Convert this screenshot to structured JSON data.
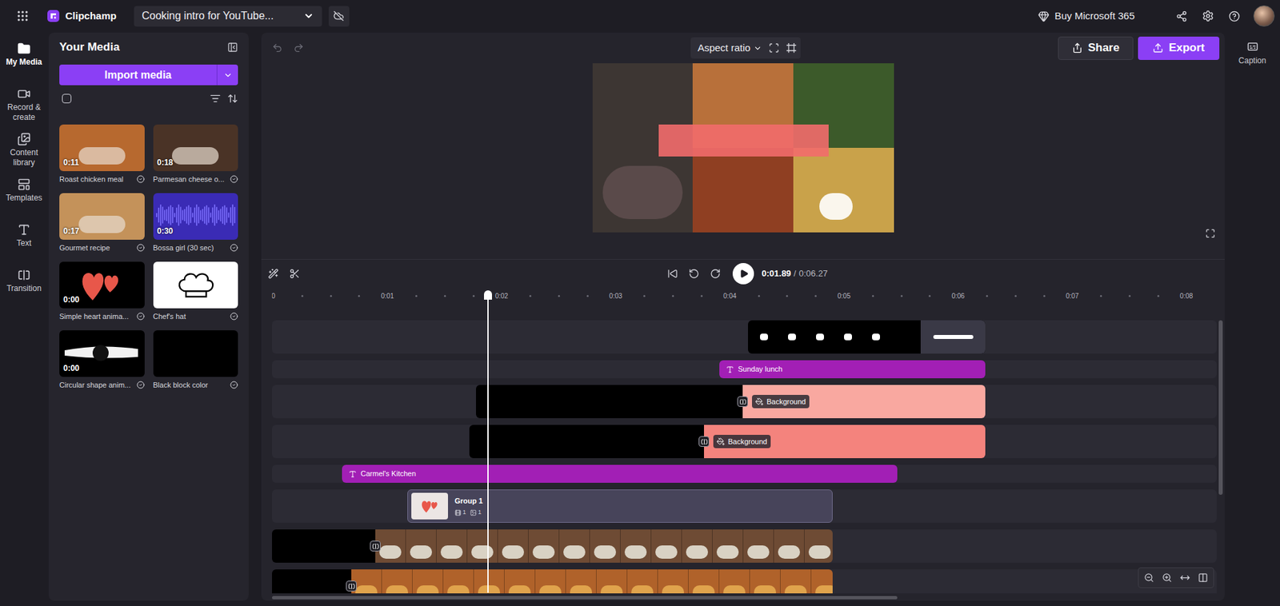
{
  "window": {
    "app_name": "Clipchamp",
    "project_title": "Cooking intro for YouTube...",
    "upgrade_label": "Buy Microsoft 365"
  },
  "nav": [
    {
      "label": "My Media",
      "selected": true
    },
    {
      "label": "Record & create",
      "selected": false
    },
    {
      "label": "Content library",
      "selected": false
    },
    {
      "label": "Templates",
      "selected": false
    },
    {
      "label": "Text",
      "selected": false
    },
    {
      "label": "Transition",
      "selected": false
    }
  ],
  "media_panel": {
    "title": "Your Media",
    "import_button": "Import media",
    "select_all": {
      "checked": false
    },
    "items": [
      {
        "name": "Roast chicken meal",
        "duration": "0:11",
        "kind": "video",
        "added": true
      },
      {
        "name": "Parmesan cheese o...",
        "duration": "0:18",
        "kind": "video",
        "added": true
      },
      {
        "name": "Gourmet recipe",
        "duration": "0:17",
        "kind": "video",
        "added": true
      },
      {
        "name": "Bossa girl (30 sec)",
        "duration": "0:30",
        "kind": "audio",
        "added": true
      },
      {
        "name": "Simple heart anima...",
        "duration": "0:00",
        "kind": "heart",
        "added": true
      },
      {
        "name": "Chef's hat",
        "kind": "hat",
        "added": true
      },
      {
        "name": "Circular shape anim...",
        "duration": "0:00",
        "kind": "shape",
        "added": true
      },
      {
        "name": "Black block color",
        "kind": "color",
        "added": true
      }
    ]
  },
  "preview": {
    "aspect_ratio": "Aspect ratio",
    "undo_disabled": true,
    "redo_disabled": true
  },
  "actions": {
    "share": "Share",
    "export": "Export"
  },
  "caption": {
    "label": "Caption"
  },
  "playback": {
    "current": "0:01.89",
    "separator": "/",
    "total": "0:06.27",
    "playing": false
  },
  "ruler": [
    "0",
    "0:01",
    "0:02",
    "0:03",
    "0:04",
    "0:05",
    "0:06",
    "0:07",
    "0:08"
  ],
  "tracks": [
    {
      "kind": "overlay"
    },
    {
      "kind": "text",
      "label": "Sunday lunch"
    },
    {
      "kind": "background",
      "label": "Background",
      "color": "#f9a8a0",
      "transition": true
    },
    {
      "kind": "background",
      "label": "Background",
      "color": "#f4837d",
      "transition": true
    },
    {
      "kind": "text",
      "label": "Carmel's Kitchen"
    },
    {
      "kind": "group",
      "label": "Group 1",
      "video_count": "1",
      "image_count": "1"
    },
    {
      "kind": "video",
      "transition": true
    },
    {
      "kind": "video",
      "transition": true
    }
  ]
}
